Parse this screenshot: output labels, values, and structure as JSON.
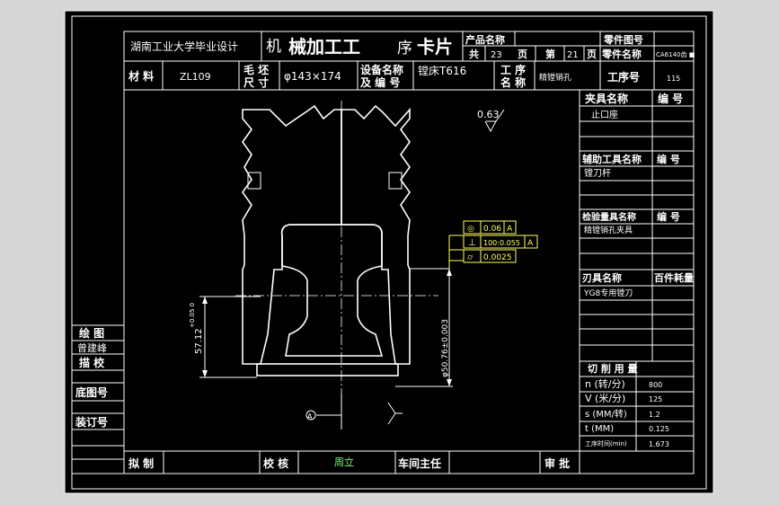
{
  "header": {
    "school": "湖南工业大学毕业设计",
    "card_title_1": "机",
    "card_title_2": "械加工工",
    "card_title_3": "序",
    "card_title_4": "卡片",
    "product_name_label": "产品名称",
    "part_drawing_label": "零件图号",
    "total_label": "共",
    "total_pages": "23",
    "page_unit_1": "页",
    "current_label": "第",
    "current_page": "21",
    "page_unit_2": "页",
    "part_name_label": "零件名称",
    "part_name_value": "CA6140齿 ■"
  },
  "info_row": {
    "material_label": "材 料",
    "material_value": "ZL109",
    "blank_label_1": "毛 坯",
    "blank_label_2": "尺 寸",
    "blank_value": "φ143×174",
    "equip_label_1": "设备名称",
    "equip_label_2": "及 编 号",
    "equip_value": "镗床T616",
    "process_label_1": "工  序",
    "process_label_2": "名  称",
    "process_value": "精镗销孔",
    "process_no_label": "工序号",
    "process_no_value": "115"
  },
  "right_panel": {
    "fixture_label": "夹具名称",
    "fixture_no_label": "编 号",
    "fixture_value": "止口座",
    "aux_label": "辅助工具名称",
    "aux_no_label": "编 号",
    "aux_value": "镗刀杆",
    "gauge_label": "检验量具名称",
    "gauge_no_label": "编 号",
    "gauge_value": "精镗销孔夹具",
    "tool_label": "刃具名称",
    "tool_cons_label": "百件耗量",
    "tool_value": "YG8专用镗刀",
    "cut_title": "切   削   用   量",
    "cut_rows": [
      {
        "label": "n (转/分)",
        "value": "800"
      },
      {
        "label": "V (米/分)",
        "value": "125"
      },
      {
        "label": "s (MM/转)",
        "value": "1.2"
      },
      {
        "label": "t (MM)",
        "value": "0.125"
      },
      {
        "label": "工序时间(min)",
        "value": "1.673"
      }
    ]
  },
  "left_strip": {
    "draw_label": "绘  图",
    "draw_name": "曾建峰",
    "trace_label": "描  校",
    "base_label": "底图号",
    "bind_label": "装订号"
  },
  "bottom": {
    "draft_label": "拟 制",
    "check_label": "校 核",
    "check_name": "周立",
    "workshop_label": "车间主任",
    "approve_label": "审 批"
  },
  "drawing": {
    "roughness": "0.63",
    "tol1_value": "0.06",
    "tol1_ref": "A",
    "tol2_value": "100:0.055",
    "tol2_ref": "A",
    "tol3_value": "0.0025",
    "dim_left": "57.12",
    "dim_left_tol": "+0.05 0",
    "dim_right": "φ50.76±0.003",
    "datum": "A"
  },
  "colors": {
    "screen": "#d6d6d6",
    "paper": "#000000",
    "line": "#ffffff",
    "highlight_green": "#7cff7c",
    "tolerance_yellow": "#ffff66"
  }
}
